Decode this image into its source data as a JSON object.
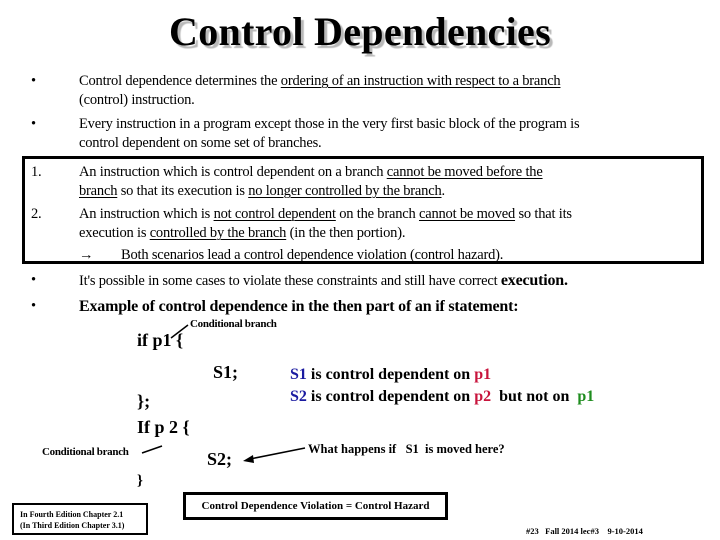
{
  "title": "Control Dependencies",
  "intro_bullets": [
    {
      "marker": "•",
      "line1_pre": "Control dependence determines the ",
      "line1_underlined": "ordering of an instruction with respect to a branch",
      "line2": "(control) instruction."
    },
    {
      "marker": "•",
      "line1": "Every instruction in a program except those in the very first basic block of the program is",
      "line2": "control dependent on some set of branches."
    }
  ],
  "boxed_rules": [
    {
      "marker": "1.",
      "l1_pre": "An instruction which is control dependent on a branch ",
      "l1_u": "cannot be moved before the",
      "l2_u1": "branch",
      "l2_mid": " so that its execution is ",
      "l2_u2": "no longer controlled by the branch",
      "l2_post": "."
    },
    {
      "marker": "2.",
      "l1_pre": "An instruction which is ",
      "l1_u1": "not control dependent",
      "l1_mid": " on the branch ",
      "l1_u2": "cannot be moved",
      "l1_post": " so that its",
      "l2_pre": "execution is ",
      "l2_u": "controlled by the branch",
      "l2_post": " (in the then portion)."
    }
  ],
  "boxed_conclusion": {
    "marker": "→",
    "text": "Both scenarios lead a control dependence violation (control hazard)."
  },
  "lower_bullets": [
    {
      "marker": "•",
      "text": "It's possible in some cases to violate these constraints and still have correct ",
      "text_bold": "execution."
    },
    {
      "marker": "•",
      "text": "Example of control dependence in the then part of an if statement:"
    }
  ],
  "code": {
    "line_if_p1": "if  p1 {",
    "line_s1": "S1;",
    "line_close1": "};",
    "line_if_p2": "If p 2  {",
    "line_s2": "S2;",
    "line_close2": "}"
  },
  "annotations": {
    "conditional_branch_1": "Conditional branch",
    "conditional_branch_2": "Conditional branch",
    "what_happens": "What happens if   S1  is moved here?"
  },
  "dependence_notes": [
    {
      "subject": "S1",
      "text": " is control dependent on ",
      "var": "p1",
      "var_color": "#c8143c"
    },
    {
      "subject": "S2",
      "text": " is control dependent on ",
      "var": "p2",
      "mid": "  but not on ",
      "var2": "p1",
      "var2_color": "#1e8c1e"
    }
  ],
  "reference_box": {
    "line1": "In Fourth Edition Chapter 2.1",
    "line2": "(In Third Edition Chapter 3.1)"
  },
  "hazard_box": "Control Dependence Violation = Control Hazard",
  "footer": "#23   Fall 2014 lec#3    9-10-2014",
  "colors": {
    "subject_blue": "#1a1aa0",
    "var_red": "#c8143c",
    "var_green": "#1e8c1e"
  }
}
